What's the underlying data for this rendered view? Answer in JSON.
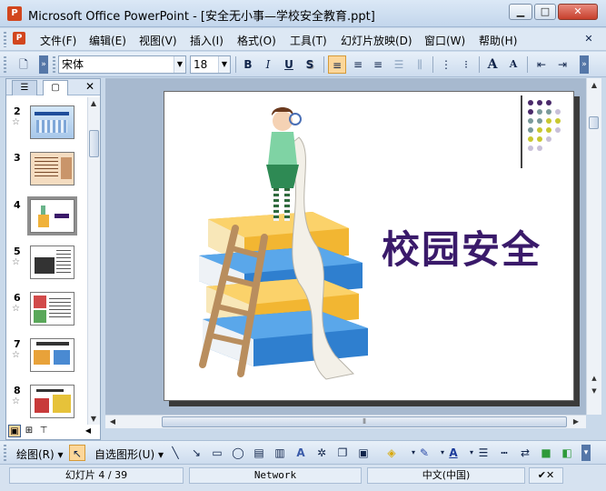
{
  "window": {
    "title": "Microsoft Office PowerPoint - [安全无小事—学校安全教育.ppt]",
    "app_icon": "powerpoint-icon",
    "minimize": "▁",
    "maximize": "□",
    "close": "✕"
  },
  "menu": {
    "items": [
      "文件(F)",
      "编辑(E)",
      "视图(V)",
      "插入(I)",
      "格式(O)",
      "工具(T)",
      "幻灯片放映(D)",
      "窗口(W)",
      "帮助(H)"
    ]
  },
  "toolbar": {
    "font_name": "宋体",
    "font_size": "18",
    "bold": "B",
    "italic": "I",
    "underline": "U",
    "shadow": "S",
    "grow_font": "A",
    "shrink_font": "A"
  },
  "colors": {
    "slide_title": "#3a1a6a",
    "accent_selected": "#fcd79a",
    "dot_purple": "#4a2a6a",
    "dot_teal": "#7a9a9a",
    "dot_yellow": "#c8c830",
    "dot_lavender": "#c8c0d8"
  },
  "slides_panel": {
    "thumbnails": [
      {
        "number": "2",
        "star": "☆",
        "icon": "slide-thumbnail-icon"
      },
      {
        "number": "3",
        "star": "",
        "icon": "slide-thumbnail-icon"
      },
      {
        "number": "4",
        "star": "",
        "icon": "slide-thumbnail-icon"
      },
      {
        "number": "5",
        "star": "☆",
        "icon": "slide-thumbnail-icon"
      },
      {
        "number": "6",
        "star": "☆",
        "icon": "slide-thumbnail-icon"
      },
      {
        "number": "7",
        "star": "☆",
        "icon": "slide-thumbnail-icon"
      },
      {
        "number": "8",
        "star": "☆",
        "icon": "slide-thumbnail-icon"
      }
    ],
    "selected": "4"
  },
  "slide": {
    "title": "校园安全"
  },
  "drawing_toolbar": {
    "draw_label": "绘图(R)",
    "autoshapes_label": "自选图形(U)"
  },
  "status": {
    "slide_info": "幻灯片 4 / 39",
    "design": "Network",
    "language": "中文(中国)"
  }
}
